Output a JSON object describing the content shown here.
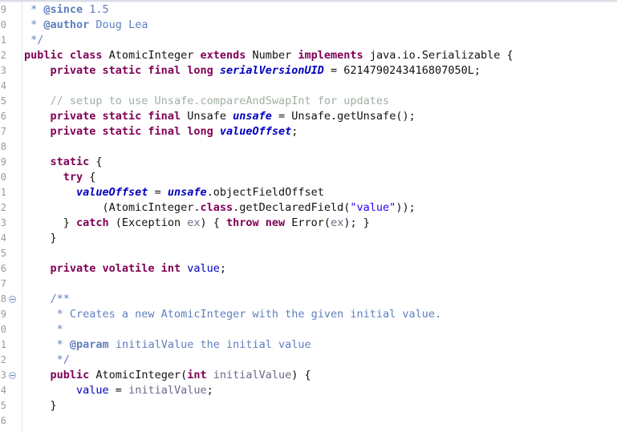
{
  "editor": {
    "kind": "java-source-editor",
    "file_language": "Java",
    "font_size_px": 13.5,
    "line_height_px": 19,
    "background": "#ffffff",
    "gutter_separator_color": "#e4e4e4",
    "colors": {
      "keyword": "#7f0055",
      "field_declaration": "#0000c0",
      "field_reference": "#0000c0",
      "string_literal": "#2a00ff",
      "line_comment": "#9fb0a3",
      "javadoc": "#5f7fbf",
      "parameter": "#6a6a8a",
      "plain_text": "#111111",
      "line_number": "#9a9a9a"
    }
  },
  "gutter": {
    "line_numbers": [
      "9",
      "0",
      "1",
      "2",
      "3",
      "4",
      "5",
      "6",
      "7",
      "8",
      "9",
      "0",
      "1",
      "2",
      "3",
      "4",
      "5",
      "6",
      "7",
      "8",
      "9",
      "0",
      "1",
      "2",
      "3",
      "4",
      "5",
      "6"
    ],
    "fold_marker_rows": [
      20,
      25
    ],
    "fold_marker_glyph": "collapse-minus-circle-icon"
  },
  "code": {
    "lines": [
      {
        "n": 1,
        "text": " * @since 1.5",
        "tokens": [
          {
            "t": " * ",
            "c": "doc"
          },
          {
            "t": "@since",
            "c": "doctag"
          },
          {
            "t": " 1.5",
            "c": "doc"
          }
        ]
      },
      {
        "n": 2,
        "text": " * @author Doug Lea",
        "tokens": [
          {
            "t": " * ",
            "c": "doc"
          },
          {
            "t": "@author",
            "c": "doctag"
          },
          {
            "t": " Doug Lea",
            "c": "doc"
          }
        ]
      },
      {
        "n": 3,
        "text": " */",
        "tokens": [
          {
            "t": " */",
            "c": "doc"
          }
        ]
      },
      {
        "n": 4,
        "text": "public class AtomicInteger extends Number implements java.io.Serializable {",
        "tokens": [
          {
            "t": "public class ",
            "c": "kw"
          },
          {
            "t": "AtomicInteger ",
            "c": "plain"
          },
          {
            "t": "extends ",
            "c": "kw"
          },
          {
            "t": "Number ",
            "c": "plain"
          },
          {
            "t": "implements ",
            "c": "kw"
          },
          {
            "t": "java.io.Serializable {",
            "c": "plain"
          }
        ]
      },
      {
        "n": 5,
        "text": "    private static final long serialVersionUID = 6214790243416807050L;",
        "tokens": [
          {
            "t": "    ",
            "c": "plain"
          },
          {
            "t": "private static final long ",
            "c": "kw"
          },
          {
            "t": "serialVersionUID",
            "c": "fld"
          },
          {
            "t": " = 6214790243416807050L;",
            "c": "plain"
          }
        ]
      },
      {
        "n": 6,
        "text": "",
        "tokens": []
      },
      {
        "n": 7,
        "text": "    // setup to use Unsafe.compareAndSwapInt for updates",
        "tokens": [
          {
            "t": "    ",
            "c": "plain"
          },
          {
            "t": "// setup to use Unsafe.compareAndSwapInt for updates",
            "c": "cmt"
          }
        ]
      },
      {
        "n": 8,
        "text": "    private static final Unsafe unsafe = Unsafe.getUnsafe();",
        "tokens": [
          {
            "t": "    ",
            "c": "plain"
          },
          {
            "t": "private static final ",
            "c": "kw"
          },
          {
            "t": "Unsafe ",
            "c": "plain"
          },
          {
            "t": "unsafe",
            "c": "fld"
          },
          {
            "t": " = Unsafe.getUnsafe();",
            "c": "plain"
          }
        ]
      },
      {
        "n": 9,
        "text": "    private static final long valueOffset;",
        "tokens": [
          {
            "t": "    ",
            "c": "plain"
          },
          {
            "t": "private static final long ",
            "c": "kw"
          },
          {
            "t": "valueOffset",
            "c": "fld"
          },
          {
            "t": ";",
            "c": "plain"
          }
        ]
      },
      {
        "n": 10,
        "text": "",
        "tokens": []
      },
      {
        "n": 11,
        "text": "    static {",
        "tokens": [
          {
            "t": "    ",
            "c": "plain"
          },
          {
            "t": "static",
            "c": "kw"
          },
          {
            "t": " {",
            "c": "plain"
          }
        ]
      },
      {
        "n": 12,
        "text": "      try {",
        "tokens": [
          {
            "t": "      ",
            "c": "plain"
          },
          {
            "t": "try",
            "c": "kw"
          },
          {
            "t": " {",
            "c": "plain"
          }
        ]
      },
      {
        "n": 13,
        "text": "        valueOffset = unsafe.objectFieldOffset",
        "tokens": [
          {
            "t": "        ",
            "c": "plain"
          },
          {
            "t": "valueOffset",
            "c": "fld"
          },
          {
            "t": " = ",
            "c": "plain"
          },
          {
            "t": "unsafe",
            "c": "fld"
          },
          {
            "t": ".objectFieldOffset",
            "c": "plain"
          }
        ]
      },
      {
        "n": 14,
        "text": "            (AtomicInteger.class.getDeclaredField(\"value\"));",
        "tokens": [
          {
            "t": "            (AtomicInteger.",
            "c": "plain"
          },
          {
            "t": "class",
            "c": "kw"
          },
          {
            "t": ".getDeclaredField(",
            "c": "plain"
          },
          {
            "t": "\"value\"",
            "c": "str"
          },
          {
            "t": "));",
            "c": "plain"
          }
        ]
      },
      {
        "n": 15,
        "text": "      } catch (Exception ex) { throw new Error(ex); }",
        "tokens": [
          {
            "t": "      } ",
            "c": "plain"
          },
          {
            "t": "catch",
            "c": "kw"
          },
          {
            "t": " (Exception ",
            "c": "plain"
          },
          {
            "t": "ex",
            "c": "param"
          },
          {
            "t": ") { ",
            "c": "plain"
          },
          {
            "t": "throw new ",
            "c": "kw"
          },
          {
            "t": "Error(",
            "c": "plain"
          },
          {
            "t": "ex",
            "c": "param"
          },
          {
            "t": "); }",
            "c": "plain"
          }
        ]
      },
      {
        "n": 16,
        "text": "    }",
        "tokens": [
          {
            "t": "    }",
            "c": "plain"
          }
        ]
      },
      {
        "n": 17,
        "text": "",
        "tokens": []
      },
      {
        "n": 18,
        "text": "    private volatile int value;",
        "tokens": [
          {
            "t": "    ",
            "c": "plain"
          },
          {
            "t": "private volatile int ",
            "c": "kw"
          },
          {
            "t": "value",
            "c": "fldref"
          },
          {
            "t": ";",
            "c": "plain"
          }
        ]
      },
      {
        "n": 19,
        "text": "",
        "tokens": []
      },
      {
        "n": 20,
        "text": "    /**",
        "tokens": [
          {
            "t": "    /**",
            "c": "doc"
          }
        ]
      },
      {
        "n": 21,
        "text": "     * Creates a new AtomicInteger with the given initial value.",
        "tokens": [
          {
            "t": "     * Creates a new AtomicInteger with the given initial value.",
            "c": "doc"
          }
        ]
      },
      {
        "n": 22,
        "text": "     *",
        "tokens": [
          {
            "t": "     *",
            "c": "doc"
          }
        ]
      },
      {
        "n": 23,
        "text": "     * @param initialValue the initial value",
        "tokens": [
          {
            "t": "     * ",
            "c": "doc"
          },
          {
            "t": "@param",
            "c": "doctag"
          },
          {
            "t": " initialValue the initial value",
            "c": "doc"
          }
        ]
      },
      {
        "n": 24,
        "text": "     */",
        "tokens": [
          {
            "t": "     */",
            "c": "doc"
          }
        ]
      },
      {
        "n": 25,
        "text": "    public AtomicInteger(int initialValue) {",
        "tokens": [
          {
            "t": "    ",
            "c": "plain"
          },
          {
            "t": "public ",
            "c": "kw"
          },
          {
            "t": "AtomicInteger(",
            "c": "plain"
          },
          {
            "t": "int",
            "c": "kw"
          },
          {
            "t": " ",
            "c": "plain"
          },
          {
            "t": "initialValue",
            "c": "param"
          },
          {
            "t": ") {",
            "c": "plain"
          }
        ]
      },
      {
        "n": 26,
        "text": "        value = initialValue;",
        "tokens": [
          {
            "t": "        ",
            "c": "plain"
          },
          {
            "t": "value",
            "c": "fldref"
          },
          {
            "t": " = ",
            "c": "plain"
          },
          {
            "t": "initialValue",
            "c": "param"
          },
          {
            "t": ";",
            "c": "plain"
          }
        ]
      },
      {
        "n": 27,
        "text": "    }",
        "tokens": [
          {
            "t": "    }",
            "c": "plain"
          }
        ]
      },
      {
        "n": 28,
        "text": "",
        "tokens": []
      }
    ]
  }
}
